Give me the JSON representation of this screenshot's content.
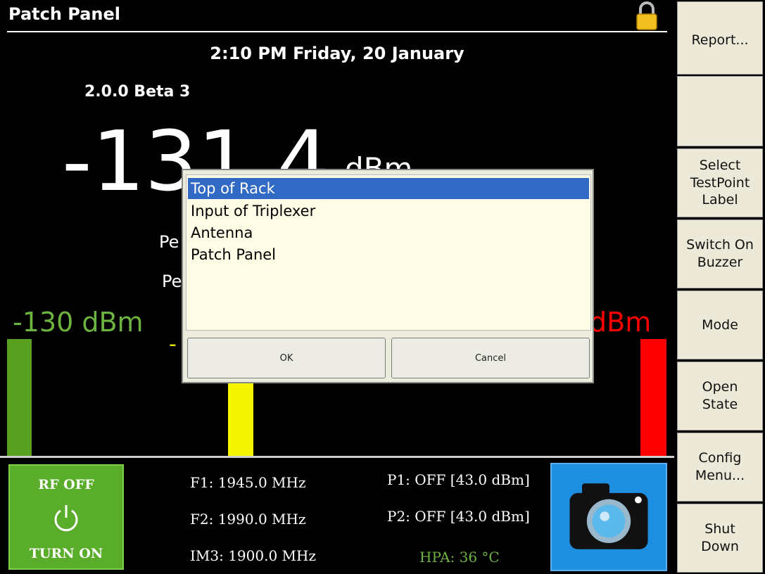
{
  "window": {
    "title": "Patch Panel",
    "lock_icon": "padlock-icon"
  },
  "status": {
    "datetime": "2:10 PM Friday, 20 January",
    "version": "2.0.0 Beta 3"
  },
  "measurement": {
    "value": "-131.4",
    "unit": "dBm",
    "partial_label_1": "Pe",
    "partial_label_2": "Pe"
  },
  "meter": {
    "low_label": "-130 dBm",
    "high_label": "dBm",
    "mid_label": "-",
    "low_color": "#5aa020",
    "mid_color": "#f5f500",
    "high_color": "#ff0000"
  },
  "bottom": {
    "rf_button": {
      "state": "RF OFF",
      "action": "TURN ON",
      "icon": "power-icon",
      "color": "#5aad2a"
    },
    "frequencies": {
      "f1": "F1: 1945.0 MHz",
      "f2": "F2: 1990.0 MHz",
      "im3": "IM3: 1900.0 MHz"
    },
    "power": {
      "p1": "P1: OFF [43.0 dBm]",
      "p2": "P2: OFF [43.0 dBm]",
      "hpa": "HPA: 36 °C"
    },
    "camera_button": {
      "icon": "camera-icon",
      "color": "#1e8ee0"
    }
  },
  "sidebar": {
    "report": "Report...",
    "select_testpoint": "Select\nTestPoint\nLabel",
    "buzzer": "Switch On\nBuzzer",
    "mode": "Mode",
    "open_state": "Open\nState",
    "config_menu": "Config\nMenu...",
    "shut_down": "Shut\nDown"
  },
  "dialog": {
    "items": [
      {
        "label": "Top of Rack",
        "selected": true
      },
      {
        "label": "Input of Triplexer",
        "selected": false
      },
      {
        "label": "Antenna",
        "selected": false
      },
      {
        "label": "Patch Panel",
        "selected": false
      }
    ],
    "ok_label": "OK",
    "cancel_label": "Cancel",
    "selection_color": "#316ac5"
  }
}
